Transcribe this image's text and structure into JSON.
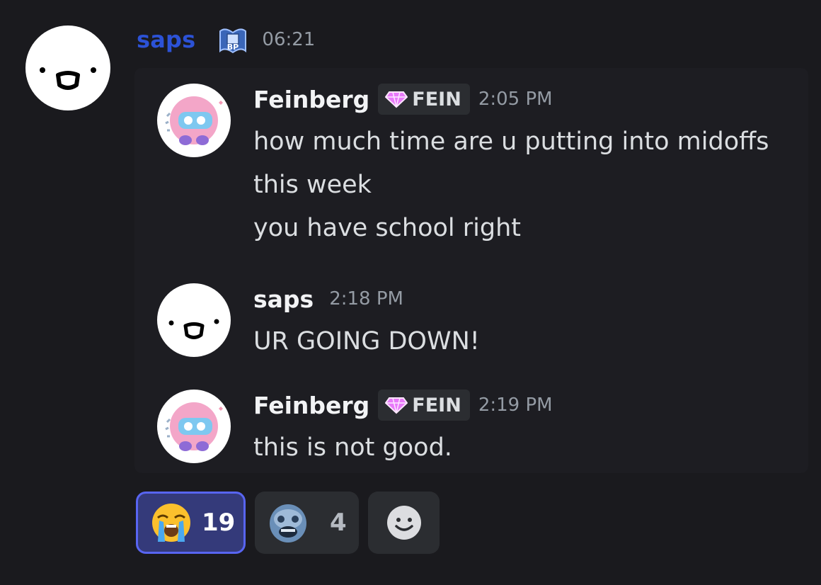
{
  "outer": {
    "username": "saps",
    "badge_text": "BP",
    "time": "06:21"
  },
  "messages": [
    {
      "username": "Feinberg",
      "tag": "FEIN",
      "time": "2:05 PM",
      "lines": [
        "how much time are u putting into midoffs",
        "this week",
        "you have school right"
      ]
    },
    {
      "username": "saps",
      "time": "2:18 PM",
      "lines": [
        "UR GOING DOWN!"
      ]
    },
    {
      "username": "Feinberg",
      "tag": "FEIN",
      "time": "2:19 PM",
      "lines": [
        "this is not good."
      ]
    }
  ],
  "reactions": [
    {
      "emoji": "loudly-crying-face",
      "count": "19",
      "active": true
    },
    {
      "emoji": "custom-blue-face",
      "count": "4",
      "active": false
    },
    {
      "emoji": "add-reaction-icon",
      "count": ""
    }
  ],
  "colors": {
    "background": "#1a1a1e",
    "outer_username": "#2c52d6",
    "active_reaction_border": "#5865f2",
    "tag_gem": "#e879f9"
  }
}
